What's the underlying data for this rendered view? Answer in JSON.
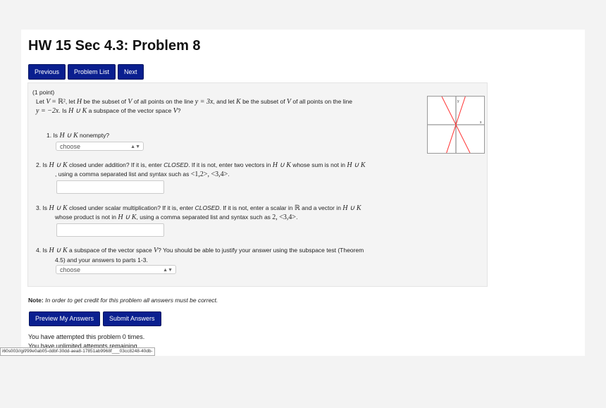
{
  "title": "HW 15 Sec 4.3: Problem 8",
  "nav": {
    "previous": "Previous",
    "problem_list": "Problem List",
    "next": "Next"
  },
  "problem": {
    "points": "(1 point)",
    "intro_line1": [
      "Let ",
      "V",
      " = ",
      "ℝ²",
      ", let ",
      "H",
      " be the subset of ",
      "V",
      " of all points on the line ",
      "y = 3x",
      ", and let ",
      "K",
      " be the subset of ",
      "V",
      " of all points on the line"
    ],
    "intro_line2": [
      "y = −2x",
      ". Is ",
      "H ∪ K",
      " a subspace of the vector space ",
      "V",
      "?"
    ],
    "q1": {
      "text": [
        "1. Is ",
        "H ∪ K",
        " nonempty?"
      ],
      "select": "choose"
    },
    "q2": {
      "line1": [
        "2. Is ",
        "H ∪ K",
        " closed under addition? If it is, enter ",
        "CLOSED",
        ". If it is not, enter two vectors in ",
        "H ∪ K",
        " whose sum is not in ",
        "H ∪ K"
      ],
      "line2": [
        ", using a comma separated list and syntax such as ",
        "<1,2>, <3,4>",
        "."
      ],
      "value": ""
    },
    "q3": {
      "line1": [
        "3. Is ",
        "H ∪ K",
        " closed under scalar multiplication? If it is, enter ",
        "CLOSED",
        ". If it is not, enter a scalar in ",
        "ℝ",
        " and a vector in ",
        "H ∪ K"
      ],
      "line2": [
        "whose product is not in ",
        "H ∪ K",
        ", using a comma separated list and syntax such as ",
        "2, <3,4>",
        "."
      ],
      "value": ""
    },
    "q4": {
      "line1": [
        "4. Is ",
        "H ∪ K",
        " a subspace of the vector space ",
        "V",
        "? You should be able to justify your answer using the subspace test (Theorem"
      ],
      "line2": "4.5) and your answers to parts 1-3.",
      "select": "choose"
    },
    "graph": {
      "x_label": "x",
      "y_label": "y",
      "slopes": [
        3,
        -2
      ],
      "line_color": "#ff3333"
    }
  },
  "note": {
    "label": "Note:",
    "text": " In order to get credit for this problem all answers must be correct."
  },
  "actions": {
    "preview": "Preview My Answers",
    "submit": "Submit Answers"
  },
  "attempts": {
    "line1": "You have attempted this problem 0 times.",
    "line2": "You have unlimited attempts remaining."
  },
  "status_url": "i60s003//gif/99e0ab05-ddbf-30dd-aea8-17851ab9968f___03cc8248-40db-"
}
